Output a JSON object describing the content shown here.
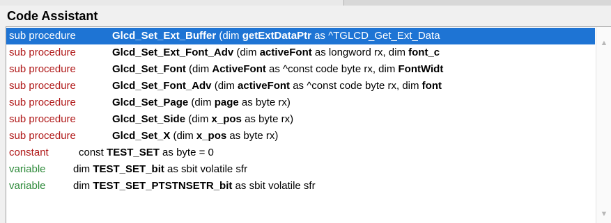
{
  "title": "Code Assistant",
  "items": [
    {
      "category": "sub procedure",
      "kind": "proc",
      "selected": true,
      "segments": [
        {
          "t": "Glcd_Set_Ext_Buffer",
          "b": true
        },
        {
          "t": " (dim ",
          "b": false
        },
        {
          "t": "getExtDataPtr",
          "b": true
        },
        {
          "t": " as ^TGLCD_Get_Ext_Data",
          "b": false
        }
      ]
    },
    {
      "category": "sub procedure",
      "kind": "proc",
      "selected": false,
      "segments": [
        {
          "t": "Glcd_Set_Ext_Font_Adv",
          "b": true
        },
        {
          "t": " (dim ",
          "b": false
        },
        {
          "t": "activeFont",
          "b": true
        },
        {
          "t": " as longword rx, dim ",
          "b": false
        },
        {
          "t": "font_c",
          "b": true
        }
      ]
    },
    {
      "category": "sub procedure",
      "kind": "proc",
      "selected": false,
      "segments": [
        {
          "t": "Glcd_Set_Font",
          "b": true
        },
        {
          "t": " (dim ",
          "b": false
        },
        {
          "t": "ActiveFont",
          "b": true
        },
        {
          "t": " as ^const code byte rx, dim ",
          "b": false
        },
        {
          "t": "FontWidt",
          "b": true
        }
      ]
    },
    {
      "category": "sub procedure",
      "kind": "proc",
      "selected": false,
      "segments": [
        {
          "t": "Glcd_Set_Font_Adv",
          "b": true
        },
        {
          "t": " (dim ",
          "b": false
        },
        {
          "t": "activeFont",
          "b": true
        },
        {
          "t": " as ^const code byte rx, dim ",
          "b": false
        },
        {
          "t": "font",
          "b": true
        }
      ]
    },
    {
      "category": "sub procedure",
      "kind": "proc",
      "selected": false,
      "segments": [
        {
          "t": "Glcd_Set_Page",
          "b": true
        },
        {
          "t": " (dim ",
          "b": false
        },
        {
          "t": "page",
          "b": true
        },
        {
          "t": " as byte rx)",
          "b": false
        }
      ]
    },
    {
      "category": "sub procedure",
      "kind": "proc",
      "selected": false,
      "segments": [
        {
          "t": "Glcd_Set_Side",
          "b": true
        },
        {
          "t": " (dim ",
          "b": false
        },
        {
          "t": "x_pos",
          "b": true
        },
        {
          "t": " as byte rx)",
          "b": false
        }
      ]
    },
    {
      "category": "sub procedure",
      "kind": "proc",
      "selected": false,
      "segments": [
        {
          "t": "Glcd_Set_X",
          "b": true
        },
        {
          "t": " (dim ",
          "b": false
        },
        {
          "t": "x_pos",
          "b": true
        },
        {
          "t": " as byte rx)",
          "b": false
        }
      ]
    },
    {
      "category": "constant",
      "kind": "const",
      "selected": false,
      "segments": [
        {
          "t": "const ",
          "b": false
        },
        {
          "t": "TEST_SET",
          "b": true
        },
        {
          "t": " as byte = 0",
          "b": false
        }
      ]
    },
    {
      "category": "variable",
      "kind": "var",
      "selected": false,
      "segments": [
        {
          "t": "dim ",
          "b": false
        },
        {
          "t": "TEST_SET_bit",
          "b": true
        },
        {
          "t": " as sbit volatile sfr",
          "b": false
        }
      ]
    },
    {
      "category": "variable",
      "kind": "var",
      "selected": false,
      "segments": [
        {
          "t": "dim ",
          "b": false
        },
        {
          "t": "TEST_SET_PTSTNSETR_bit",
          "b": true
        },
        {
          "t": " as sbit volatile sfr",
          "b": false
        }
      ]
    }
  ],
  "scrollbar": {
    "up_icon": "scroll-up-arrow-icon",
    "down_icon": "scroll-down-arrow-icon"
  },
  "colors": {
    "selection": "#1e74d4",
    "procedure_category": "#b01818",
    "constant_category": "#b01818",
    "variable_category": "#2e8a3a"
  }
}
